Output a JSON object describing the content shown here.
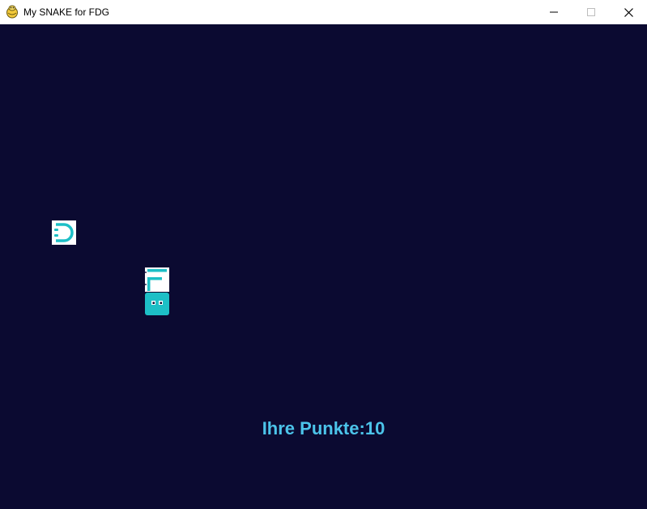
{
  "window": {
    "title": "My SNAKE for FDG",
    "icon": "pygame-snake-icon",
    "controls": [
      "minimize-icon",
      "maximize-icon",
      "close-icon"
    ]
  },
  "game": {
    "background_color": "#0b0a31",
    "accent_color": "#1dbfc6",
    "score_color": "#4cc4ea",
    "score_label": "Ihre Punkte:",
    "score_value": "10",
    "score_text": "Ihre Punkte:10",
    "sprites": [
      "food-d-icon",
      "snake-body-f-icon",
      "snake-head-icon"
    ]
  }
}
